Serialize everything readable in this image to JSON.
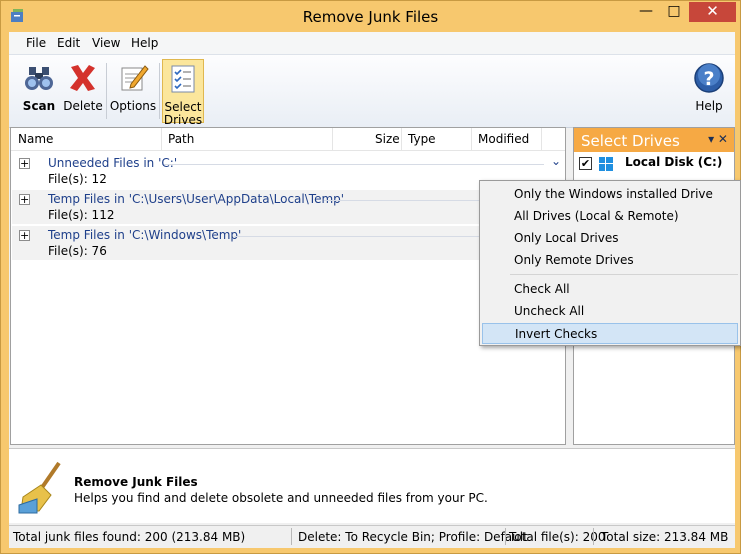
{
  "window": {
    "title": "Remove Junk Files",
    "min": "—",
    "max": "□",
    "close": "✕"
  },
  "menus": [
    "File",
    "Edit",
    "View",
    "Help"
  ],
  "toolbar": {
    "scan": "Scan",
    "delete": "Delete",
    "options": "Options",
    "select_drives_1": "Select",
    "select_drives_2": "Drives",
    "help": "Help"
  },
  "columns": [
    "Name",
    "Path",
    "Size",
    "Type",
    "Modified"
  ],
  "groups": [
    {
      "title": "Unneeded Files in 'C:'",
      "count": "File(s): 12"
    },
    {
      "title": "Temp Files in 'C:\\Users\\User\\AppData\\Local\\Temp'",
      "count": "File(s): 112"
    },
    {
      "title": "Temp Files in 'C:\\Windows\\Temp'",
      "count": "File(s): 76"
    }
  ],
  "drives": {
    "title": "Select Drives",
    "controls": "▾ ✕",
    "items": [
      {
        "name": "Local Disk (C:)",
        "checked": true,
        "check_glyph": "✔"
      }
    ]
  },
  "context_menu": {
    "items": [
      "Only the Windows installed Drive",
      "All Drives (Local & Remote)",
      "Only Local Drives",
      "Only Remote Drives",
      "Check All",
      "Uncheck All",
      "Invert Checks"
    ],
    "highlighted_index": 6
  },
  "info": {
    "title": "Remove Junk Files",
    "description": "Helps you find and delete obsolete and unneeded files from your PC."
  },
  "status": {
    "found": "Total junk files found: 200 (213.84 MB)",
    "delete": "Delete: To Recycle Bin; Profile: Default",
    "total_files": "Total file(s): 200",
    "total_size": "Total size: 213.84 MB"
  },
  "colors": {
    "title_bg": "#f7c86e",
    "drive_header": "#f6a944",
    "group_text": "#1e3f8a",
    "close_btn": "#c7473a"
  }
}
